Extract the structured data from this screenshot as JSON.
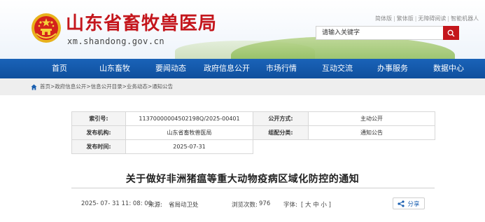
{
  "header": {
    "site_title": "山东省畜牧兽医局",
    "site_domain": "xm.shandong.gov.cn",
    "util_links": [
      "简体版",
      "繁体版",
      "无障碍阅读",
      "智能机器人"
    ],
    "search_placeholder": "请输入关键字",
    "emblem_icon": "national-emblem-icon",
    "search_icon": "search-icon",
    "brand_red": "#c4161c"
  },
  "nav": {
    "items": [
      "首页",
      "山东畜牧",
      "要闻动态",
      "政府信息公开",
      "市场行情",
      "互动交流",
      "办事服务",
      "数据中心"
    ],
    "color": "#1a63b8"
  },
  "breadcrumb": {
    "items": [
      "首页",
      "政府信息公开",
      "信息公开目录",
      "业务动态",
      "通知公告"
    ],
    "separator": ">"
  },
  "meta": {
    "index_label": "索引号:",
    "index_value": "11370000004502198Q/2025-00401",
    "open_mode_label": "公开方式:",
    "open_mode_value": "主动公开",
    "publisher_label": "发布机构:",
    "publisher_value": "山东省畜牧兽医局",
    "category_label": "组配分类:",
    "category_value": "通知公告",
    "date_label": "发布时间:",
    "date_value": "2025-07-31"
  },
  "article": {
    "title": "关于做好非洲猪瘟等重大动物疫病区域化防控的通知",
    "datetime": "2025- 07- 31 11: 08: 00",
    "source_label": "来源:",
    "source": "省局动卫处",
    "views_label": "浏览次数:",
    "views": "976",
    "font_label": "字体:",
    "font_options": "[ 大 中 小 ]",
    "share_label": "分享",
    "share_icon": "share-icon"
  }
}
